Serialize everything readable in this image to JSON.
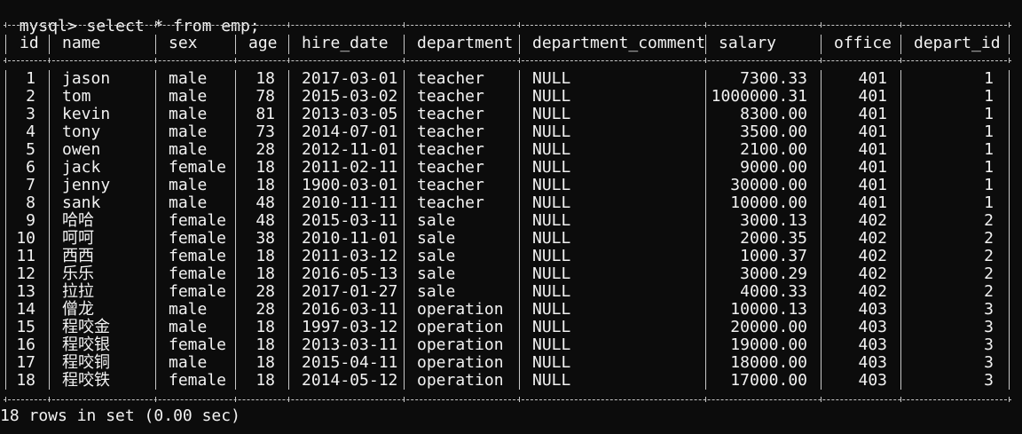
{
  "terminal": {
    "prompt": "mysql>",
    "command": " select * from emp;",
    "footer": "18 rows in set (0.00 sec)"
  },
  "table": {
    "columns": [
      "id",
      "name",
      "sex",
      "age",
      "hire_date",
      "department",
      "department_comment",
      "salary",
      "office",
      "depart_id"
    ],
    "rows": [
      [
        "1",
        "jason",
        "male",
        "18",
        "2017-03-01",
        "teacher",
        "NULL",
        "7300.33",
        "401",
        "1"
      ],
      [
        "2",
        "tom",
        "male",
        "78",
        "2015-03-02",
        "teacher",
        "NULL",
        "1000000.31",
        "401",
        "1"
      ],
      [
        "3",
        "kevin",
        "male",
        "81",
        "2013-03-05",
        "teacher",
        "NULL",
        "8300.00",
        "401",
        "1"
      ],
      [
        "4",
        "tony",
        "male",
        "73",
        "2014-07-01",
        "teacher",
        "NULL",
        "3500.00",
        "401",
        "1"
      ],
      [
        "5",
        "owen",
        "male",
        "28",
        "2012-11-01",
        "teacher",
        "NULL",
        "2100.00",
        "401",
        "1"
      ],
      [
        "6",
        "jack",
        "female",
        "18",
        "2011-02-11",
        "teacher",
        "NULL",
        "9000.00",
        "401",
        "1"
      ],
      [
        "7",
        "jenny",
        "male",
        "18",
        "1900-03-01",
        "teacher",
        "NULL",
        "30000.00",
        "401",
        "1"
      ],
      [
        "8",
        "sank",
        "male",
        "48",
        "2010-11-11",
        "teacher",
        "NULL",
        "10000.00",
        "401",
        "1"
      ],
      [
        "9",
        "哈哈",
        "female",
        "48",
        "2015-03-11",
        "sale",
        "NULL",
        "3000.13",
        "402",
        "2"
      ],
      [
        "10",
        "呵呵",
        "female",
        "38",
        "2010-11-01",
        "sale",
        "NULL",
        "2000.35",
        "402",
        "2"
      ],
      [
        "11",
        "西西",
        "female",
        "18",
        "2011-03-12",
        "sale",
        "NULL",
        "1000.37",
        "402",
        "2"
      ],
      [
        "12",
        "乐乐",
        "female",
        "18",
        "2016-05-13",
        "sale",
        "NULL",
        "3000.29",
        "402",
        "2"
      ],
      [
        "13",
        "拉拉",
        "female",
        "28",
        "2017-01-27",
        "sale",
        "NULL",
        "4000.33",
        "402",
        "2"
      ],
      [
        "14",
        "僧龙",
        "male",
        "28",
        "2016-03-11",
        "operation",
        "NULL",
        "10000.13",
        "403",
        "3"
      ],
      [
        "15",
        "程咬金",
        "male",
        "18",
        "1997-03-12",
        "operation",
        "NULL",
        "20000.00",
        "403",
        "3"
      ],
      [
        "16",
        "程咬银",
        "female",
        "18",
        "2013-03-11",
        "operation",
        "NULL",
        "19000.00",
        "403",
        "3"
      ],
      [
        "17",
        "程咬铜",
        "male",
        "18",
        "2015-04-11",
        "operation",
        "NULL",
        "18000.00",
        "403",
        "3"
      ],
      [
        "18",
        "程咬铁",
        "female",
        "18",
        "2014-05-12",
        "operation",
        "NULL",
        "17000.00",
        "403",
        "3"
      ]
    ]
  },
  "colors": {
    "background": "#0c0c0c",
    "text": "#f2f2f2",
    "border": "#c8c8c8"
  }
}
